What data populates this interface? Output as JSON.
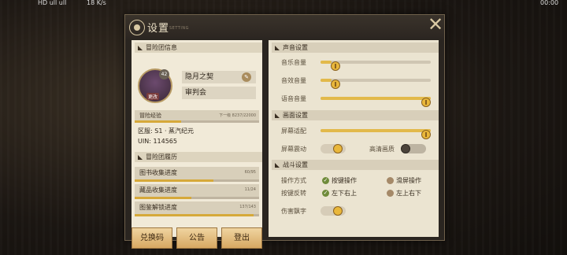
{
  "statusbar": {
    "left": "HD ull ull",
    "speed": "18 K/s",
    "time": "00:00"
  },
  "panel": {
    "title": "设置",
    "subtitle": "SETTING"
  },
  "profile": {
    "header": "冒险团信息",
    "level": "42",
    "change_label": "更改",
    "name": "隐月之契",
    "guild": "审判会",
    "exp_label": "冒险经验",
    "exp_value": "下一级 8237/22000",
    "exp_progress": 0.374,
    "server": "区服: S1 · 蒸汽纪元",
    "uin": "UIN: 114565"
  },
  "history": {
    "header": "冒险团履历",
    "items": [
      {
        "label": "图书收集进度",
        "value": "60/95",
        "progress": 0.632
      },
      {
        "label": "藏品收集进度",
        "value": "11/24",
        "progress": 0.458
      },
      {
        "label": "图鉴解锁进度",
        "value": "137/143",
        "progress": 0.958
      }
    ]
  },
  "buttons": {
    "redeem": "兑换码",
    "notice": "公告",
    "logout": "登出"
  },
  "sound": {
    "header": "声音设置",
    "music": {
      "label": "音乐音量",
      "level": 0.1
    },
    "sfx": {
      "label": "音效音量",
      "level": 0.1
    },
    "voice": {
      "label": "语音音量",
      "level": 1.0
    }
  },
  "display": {
    "header": "画面设置",
    "fit": {
      "label": "屏幕适配",
      "level": 1.0
    },
    "shake": {
      "label": "屏幕震动",
      "on": true
    },
    "hd": {
      "label": "高清画质",
      "on": false
    }
  },
  "battle": {
    "header": "战斗设置",
    "op_mode": {
      "label": "操作方式",
      "opt1": "按键操作",
      "opt2": "滑屏操作"
    },
    "key_mode": {
      "label": "按键反转",
      "opt1": "左下右上",
      "opt2": "左上右下"
    },
    "damage": {
      "label": "伤害飘字",
      "on": true
    }
  },
  "colors": {
    "accent": "#e2b94a",
    "panel": "#2a2520",
    "paper": "#f1ead8"
  }
}
